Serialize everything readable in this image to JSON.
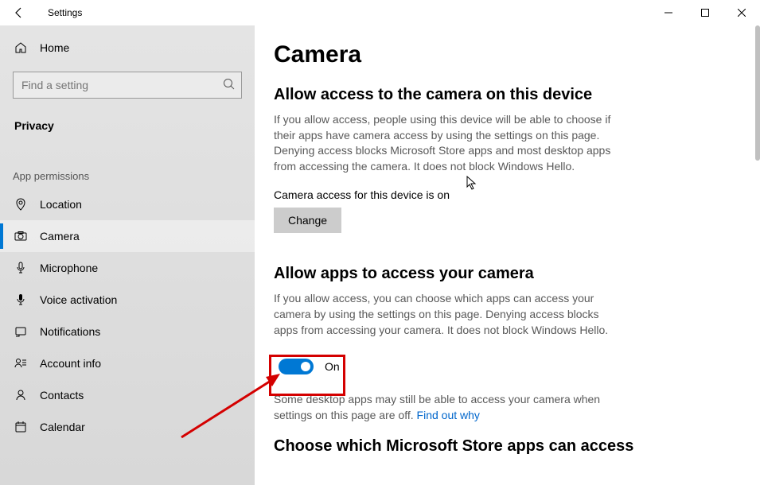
{
  "window": {
    "title": "Settings"
  },
  "sidebar": {
    "home_label": "Home",
    "search_placeholder": "Find a setting",
    "category_label": "Privacy",
    "section_label": "App permissions",
    "items": [
      {
        "label": "Location"
      },
      {
        "label": "Camera"
      },
      {
        "label": "Microphone"
      },
      {
        "label": "Voice activation"
      },
      {
        "label": "Notifications"
      },
      {
        "label": "Account info"
      },
      {
        "label": "Contacts"
      },
      {
        "label": "Calendar"
      }
    ]
  },
  "content": {
    "page_title": "Camera",
    "section1_heading": "Allow access to the camera on this device",
    "section1_body": "If you allow access, people using this device will be able to choose if their apps have camera access by using the settings on this page. Denying access blocks Microsoft Store apps and most desktop apps from accessing the camera. It does not block Windows Hello.",
    "device_status": "Camera access for this device is on",
    "change_label": "Change",
    "section2_heading": "Allow apps to access your camera",
    "section2_body": "If you allow access, you can choose which apps can access your camera by using the settings on this page. Denying access blocks apps from accessing your camera. It does not block Windows Hello.",
    "toggle_state": "On",
    "desktop_note": "Some desktop apps may still be able to access your camera when settings on this page are off. ",
    "find_out_why": "Find out why",
    "section3_heading": "Choose which Microsoft Store apps can access"
  }
}
